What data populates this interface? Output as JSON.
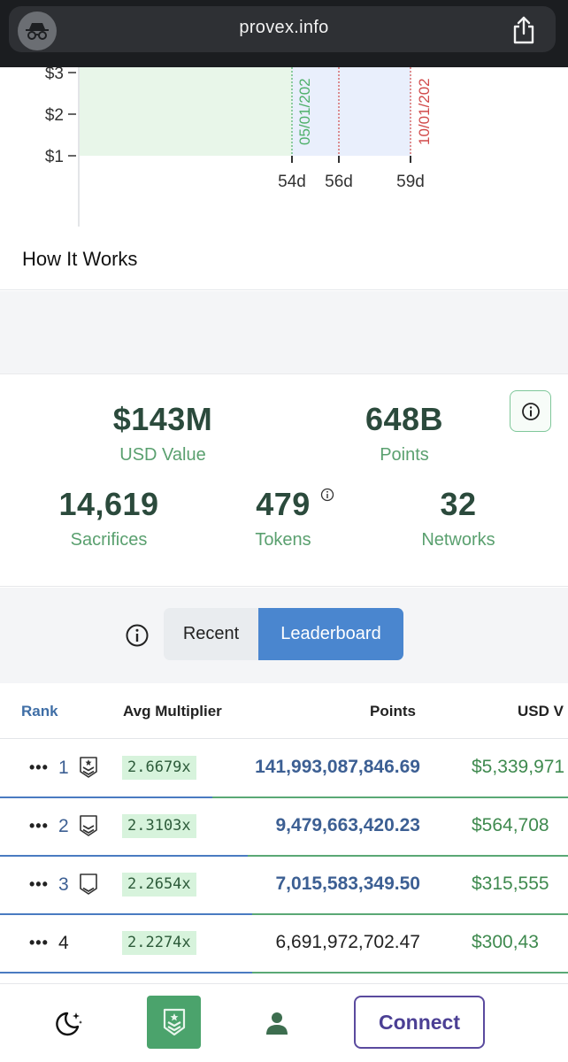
{
  "browser": {
    "url": "provex.info"
  },
  "chart_data": {
    "type": "area",
    "y_tick_labels": [
      "$3",
      "$2",
      "$1"
    ],
    "x_tick_labels": [
      "54d",
      "56d",
      "59d"
    ],
    "annotations": [
      "05/01/202",
      "10/01/202"
    ],
    "colors": {
      "green_region": "#e8f6e9",
      "blue_region": "#e9effc",
      "green_line": "#4fb06a",
      "red_line": "#d14a4a"
    }
  },
  "how_it_works": {
    "title": "How It Works"
  },
  "stats": {
    "usd_value": {
      "value": "$143M",
      "label": "USD Value"
    },
    "points": {
      "value": "648B",
      "label": "Points"
    },
    "sacrifices": {
      "value": "14,619",
      "label": "Sacrifices"
    },
    "tokens": {
      "value": "479",
      "label": "Tokens"
    },
    "networks": {
      "value": "32",
      "label": "Networks"
    }
  },
  "tabs": {
    "recent": "Recent",
    "leaderboard": "Leaderboard",
    "active": "leaderboard"
  },
  "table": {
    "headers": {
      "rank": "Rank",
      "avg_multiplier": "Avg Multiplier",
      "points": "Points",
      "usd": "USD V"
    },
    "rows": [
      {
        "rank": "1",
        "multiplier": "2.6679x",
        "points": "141,993,087,846.69",
        "usd": "$5,339,971",
        "points_color": "#3c5f93",
        "rank_color": "#3c5f93",
        "badge_fill": 1.0
      },
      {
        "rank": "2",
        "multiplier": "2.3103x",
        "points": "9,479,663,420.23",
        "usd": "$564,708",
        "points_color": "#3c5f93",
        "rank_color": "#3c5f93",
        "badge_fill": 0.66
      },
      {
        "rank": "3",
        "multiplier": "2.2654x",
        "points": "7,015,583,349.50",
        "usd": "$315,555",
        "points_color": "#3c5f93",
        "rank_color": "#3c5f93",
        "badge_fill": 0.33
      },
      {
        "rank": "4",
        "multiplier": "2.2274x",
        "points": "6,691,972,702.47",
        "usd": "$300,43",
        "points_color": "#222222",
        "rank_color": "#222222",
        "badge_fill": 0
      }
    ],
    "row_divider_colors": {
      "blue": "#4a7bc1",
      "green": "#5aa875"
    }
  },
  "bottom_nav": {
    "connect_label": "Connect"
  }
}
